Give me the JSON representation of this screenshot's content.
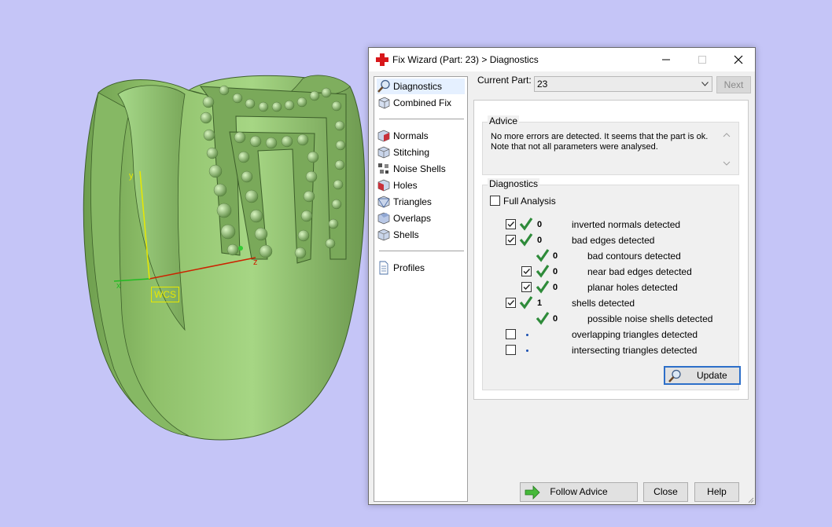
{
  "viewport": {
    "wcs_label": "WCS",
    "axis_x": "x",
    "axis_y": "y",
    "axis_z": "z"
  },
  "window": {
    "title": "Fix Wizard (Part: 23) > Diagnostics",
    "title_icon": "red-cross-icon",
    "buttons": {
      "minimize": "minimize-icon",
      "maximize": "maximize-icon",
      "close": "close-icon"
    }
  },
  "nav": {
    "top_items": [
      {
        "label": "Diagnostics",
        "icon": "magnifier-icon",
        "selected": true
      },
      {
        "label": "Combined Fix",
        "icon": "cube-icon",
        "selected": false
      }
    ],
    "fix_items": [
      {
        "label": "Normals",
        "icon": "normals-cube-icon"
      },
      {
        "label": "Stitching",
        "icon": "stitching-cube-icon"
      },
      {
        "label": "Noise Shells",
        "icon": "noise-shells-icon"
      },
      {
        "label": "Holes",
        "icon": "holes-cube-icon"
      },
      {
        "label": "Triangles",
        "icon": "triangles-cube-icon"
      },
      {
        "label": "Overlaps",
        "icon": "overlaps-cube-icon"
      },
      {
        "label": "Shells",
        "icon": "shells-cube-icon"
      }
    ],
    "bottom_items": [
      {
        "label": "Profiles",
        "icon": "document-icon"
      }
    ]
  },
  "part": {
    "label": "Current Part:",
    "value": "23",
    "next_label": "Next"
  },
  "advice": {
    "title": "Advice",
    "text": "No more errors are detected. It seems that the part is ok. Note that not all parameters were analysed."
  },
  "diagnostics": {
    "title": "Diagnostics",
    "full_analysis_label": "Full Analysis",
    "full_analysis_checked": false,
    "rows": [
      {
        "checkbox": true,
        "checked": true,
        "status": "ok",
        "count": "0",
        "label": "inverted normals detected",
        "indent": 0
      },
      {
        "checkbox": true,
        "checked": true,
        "status": "ok",
        "count": "0",
        "label": "bad edges detected",
        "indent": 0
      },
      {
        "checkbox": false,
        "checked": false,
        "status": "ok",
        "count": "0",
        "label": "bad contours detected",
        "indent": 1
      },
      {
        "checkbox": true,
        "checked": true,
        "status": "ok",
        "count": "0",
        "label": "near bad edges detected",
        "indent": 1
      },
      {
        "checkbox": true,
        "checked": true,
        "status": "ok",
        "count": "0",
        "label": "planar holes detected",
        "indent": 1
      },
      {
        "checkbox": true,
        "checked": true,
        "status": "ok",
        "count": "1",
        "label": "shells detected",
        "indent": 0
      },
      {
        "checkbox": false,
        "checked": false,
        "status": "ok",
        "count": "0",
        "label": "possible noise shells detected",
        "indent": 1
      },
      {
        "checkbox": true,
        "checked": false,
        "status": "none",
        "count": "",
        "label": "overlapping triangles detected",
        "indent": 0
      },
      {
        "checkbox": true,
        "checked": false,
        "status": "none",
        "count": "",
        "label": "intersecting triangles detected",
        "indent": 0
      }
    ],
    "update_label": "Update"
  },
  "footer": {
    "follow_advice_label": "Follow Advice",
    "close_label": "Close",
    "help_label": "Help"
  },
  "colors": {
    "background": "#c5c5f7",
    "model": "#9ccc78",
    "ok_tick": "#2e8b3a",
    "accent": "#2d6fc9"
  }
}
